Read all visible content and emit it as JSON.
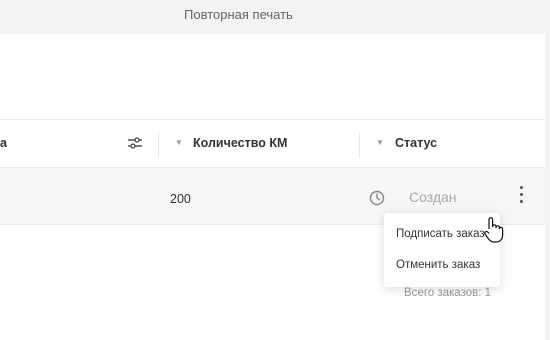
{
  "window": {
    "title": "Повторная печать"
  },
  "table": {
    "columns": [
      {
        "label": "а"
      },
      {
        "label": "Количество КМ"
      },
      {
        "label": "Статус"
      }
    ],
    "rows": [
      {
        "quantity": "200",
        "status": "Создан"
      }
    ]
  },
  "context_menu": {
    "items": [
      {
        "label": "Подписать заказ"
      },
      {
        "label": "Отменить заказ"
      }
    ]
  },
  "footer": {
    "total_label": "Всего заказов: 1"
  },
  "icons": {
    "filter": "sliders-icon",
    "status": "clock-icon",
    "row_menu": "kebab-icon",
    "pointer": "hand-cursor-icon"
  },
  "colors": {
    "background": "#f3f3f3",
    "panel": "#ffffff",
    "row_highlight": "#f6f6f6",
    "status_text": "#a9a9a9"
  }
}
